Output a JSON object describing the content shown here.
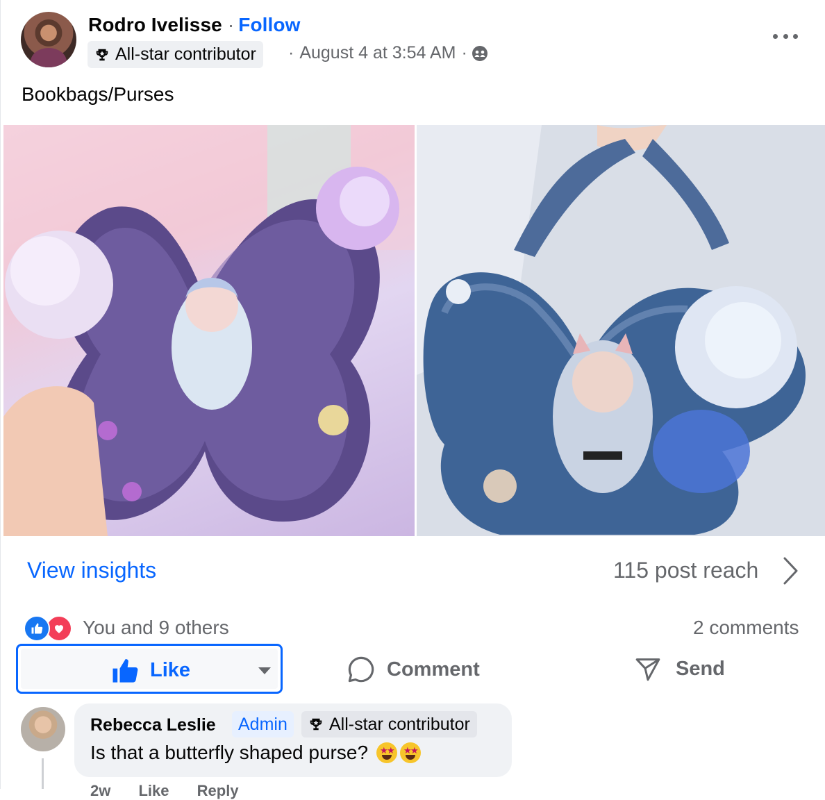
{
  "post": {
    "author": "Rodro Ivelisse",
    "separator": "·",
    "follow": "Follow",
    "badge": "All-star contributor",
    "timestamp": "August 4 at 3:54 AM",
    "meta_sep": "·",
    "text": "Bookbags/Purses",
    "icons": {
      "more": "more-horizontal-icon",
      "audience": "group-audience-icon",
      "badge": "trophy-icon"
    }
  },
  "insights": {
    "link": "View insights",
    "reach": "115 post reach"
  },
  "reactions": {
    "summary": "You and 9 others",
    "comments": "2 comments",
    "types": [
      "like",
      "love"
    ]
  },
  "actions": {
    "like": "Like",
    "comment": "Comment",
    "send": "Send"
  },
  "comment": {
    "name": "Rebecca Leslie",
    "role": "Admin",
    "badge": "All-star contributor",
    "text": "Is that a butterfly shaped purse?",
    "actions": [
      "2w",
      "Like",
      "Reply"
    ]
  },
  "colors": {
    "accent": "#0866ff",
    "muted": "#65676b",
    "bubble": "#f0f2f5"
  }
}
